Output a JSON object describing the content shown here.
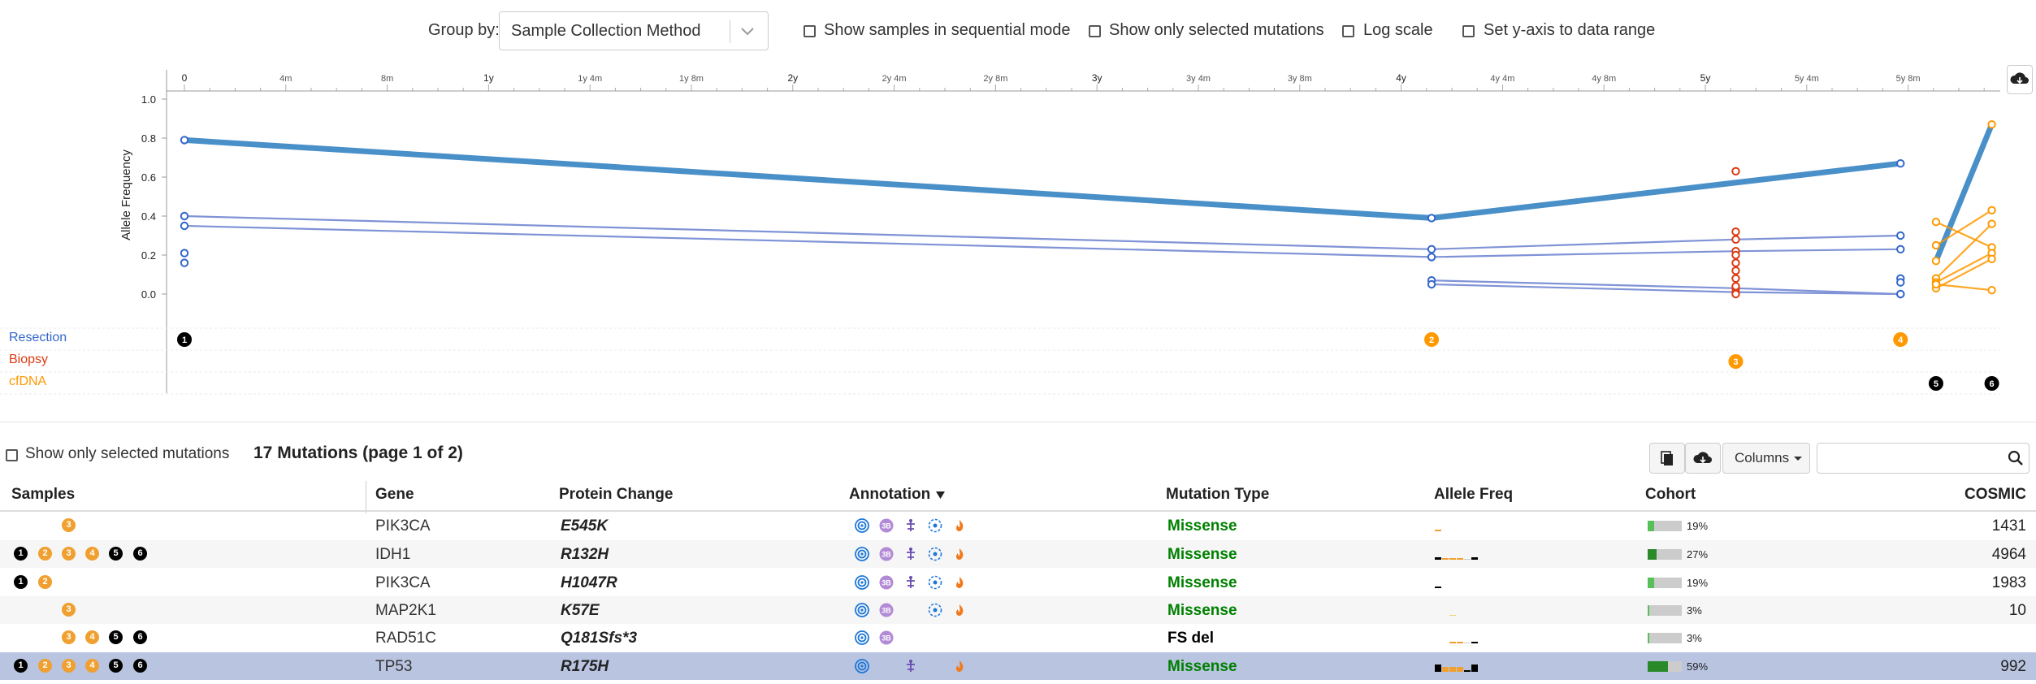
{
  "controls": {
    "group_by_label": "Group by:",
    "group_by_value": "Sample Collection Method",
    "sequential_label": "Show samples in sequential mode",
    "selected_only_label": "Show only selected mutations",
    "log_scale_label": "Log scale",
    "y_range_label": "Set y-axis to data range"
  },
  "chart_data": {
    "type": "line",
    "ylabel": "Allele Frequency",
    "ylim": [
      0,
      1.0
    ],
    "y_ticks": [
      "1.0",
      "0.8",
      "0.6",
      "0.4",
      "0.2",
      "0.0"
    ],
    "x_ticks": [
      "0",
      "4m",
      "8m",
      "1y",
      "1y 4m",
      "1y 8m",
      "2y",
      "2y 4m",
      "2y 8m",
      "3y",
      "3y 4m",
      "3y 8m",
      "4y",
      "4y 4m",
      "4y 8m",
      "5y",
      "5y 4m",
      "5y 8m"
    ],
    "x_months": [
      0,
      4,
      8,
      12,
      16,
      20,
      24,
      28,
      32,
      36,
      40,
      44,
      48,
      52,
      56,
      60,
      64,
      68
    ],
    "samples": [
      {
        "label": "1",
        "months": 0,
        "group": "Resection"
      },
      {
        "label": "2",
        "months": 49.2,
        "group": "Resection"
      },
      {
        "label": "3",
        "months": 61.2,
        "group": "Biopsy"
      },
      {
        "label": "4",
        "months": 67.7,
        "group": "Resection"
      },
      {
        "label": "5",
        "months": 69.1,
        "group": "cfDNA"
      },
      {
        "label": "6",
        "months": 71.3,
        "group": "cfDNA"
      }
    ],
    "series": [
      {
        "values": [
          [
            0,
            0.79
          ],
          [
            49.2,
            0.39
          ],
          [
            67.7,
            0.67
          ]
        ],
        "highlight": true
      },
      {
        "values": [
          [
            0,
            0.4
          ],
          [
            49.2,
            0.23
          ],
          [
            61.2,
            0.28
          ],
          [
            67.7,
            0.3
          ]
        ]
      },
      {
        "values": [
          [
            0,
            0.35
          ],
          [
            49.2,
            0.19
          ],
          [
            61.2,
            0.22
          ],
          [
            67.7,
            0.23
          ]
        ]
      },
      {
        "values": [
          [
            49.2,
            0.07
          ],
          [
            61.2,
            0.03
          ],
          [
            67.7,
            0.0
          ]
        ]
      },
      {
        "values": [
          [
            49.2,
            0.05
          ],
          [
            61.2,
            0.01
          ],
          [
            67.7,
            0.0
          ]
        ]
      },
      {
        "values": [
          [
            69.1,
            0.17
          ],
          [
            71.3,
            0.87
          ]
        ],
        "highlight": true,
        "group": "cfDNA"
      },
      {
        "values": [
          [
            69.1,
            0.37
          ],
          [
            71.3,
            0.24
          ]
        ],
        "group": "cfDNA"
      },
      {
        "values": [
          [
            69.1,
            0.25
          ],
          [
            71.3,
            0.43
          ]
        ],
        "group": "cfDNA"
      },
      {
        "values": [
          [
            69.1,
            0.08
          ],
          [
            71.3,
            0.36
          ]
        ],
        "group": "cfDNA"
      },
      {
        "values": [
          [
            69.1,
            0.06
          ],
          [
            71.3,
            0.21
          ]
        ],
        "group": "cfDNA"
      },
      {
        "values": [
          [
            69.1,
            0.03
          ],
          [
            71.3,
            0.18
          ]
        ],
        "group": "cfDNA"
      },
      {
        "values": [
          [
            69.1,
            0.05
          ],
          [
            71.3,
            0.02
          ]
        ],
        "group": "cfDNA"
      }
    ],
    "unconnected_points": [
      {
        "months": 0,
        "values": [
          0.21,
          0.16
        ],
        "group": "Resection"
      },
      {
        "months": 61.2,
        "values": [
          0.63,
          0.32,
          0.2,
          0.16,
          0.12,
          0.08,
          0.04,
          0.0
        ],
        "group": "Biopsy"
      },
      {
        "months": 67.7,
        "values": [
          0.08,
          0.06
        ],
        "group": "Resection"
      }
    ],
    "groups": [
      {
        "name": "Resection",
        "color": "#3366cc"
      },
      {
        "name": "Biopsy",
        "color": "#dc3912"
      },
      {
        "name": "cfDNA",
        "color": "#ff9900"
      }
    ],
    "highlight_color": "#4a90c8"
  },
  "table": {
    "selected_only_label": "Show only selected mutations",
    "title": "17 Mutations (page 1 of 2)",
    "columns_button": "Columns",
    "headers": {
      "samples": "Samples",
      "gene": "Gene",
      "protein": "Protein Change",
      "annotation": "Annotation",
      "mutation_type": "Mutation Type",
      "allele_freq": "Allele Freq",
      "cohort": "Cohort",
      "cosmic": "COSMIC"
    },
    "rows": [
      {
        "gene": "PIK3CA",
        "protein": "E545K",
        "mutation_type": "Missense",
        "cohort_pct": "19%",
        "cohort_value": 0.19,
        "cosmic": "1431",
        "samples": [
          "3"
        ]
      },
      {
        "gene": "IDH1",
        "protein": "R132H",
        "mutation_type": "Missense",
        "cohort_pct": "27%",
        "cohort_value": 0.27,
        "cosmic": "4964",
        "samples": [
          "1",
          "2",
          "3",
          "4",
          "5",
          "6"
        ]
      },
      {
        "gene": "PIK3CA",
        "protein": "H1047R",
        "mutation_type": "Missense",
        "cohort_pct": "19%",
        "cohort_value": 0.19,
        "cosmic": "1983",
        "samples": [
          "1",
          "2"
        ]
      },
      {
        "gene": "MAP2K1",
        "protein": "K57E",
        "mutation_type": "Missense",
        "cohort_pct": "3%",
        "cohort_value": 0.03,
        "cosmic": "10",
        "samples": [
          "3"
        ]
      },
      {
        "gene": "RAD51C",
        "protein": "Q181Sfs*3",
        "mutation_type": "FS del",
        "cohort_pct": "3%",
        "cohort_value": 0.03,
        "cosmic": "",
        "samples": [
          "3",
          "4",
          "5",
          "6"
        ]
      },
      {
        "gene": "TP53",
        "protein": "R175H",
        "mutation_type": "Missense",
        "cohort_pct": "59%",
        "cohort_value": 0.59,
        "cosmic": "992",
        "samples": [
          "1",
          "2",
          "3",
          "4",
          "5",
          "6"
        ]
      }
    ]
  },
  "colors": {
    "missense": "#008000",
    "fs_del": "#000000",
    "selected_row": "#b8c4e0"
  }
}
